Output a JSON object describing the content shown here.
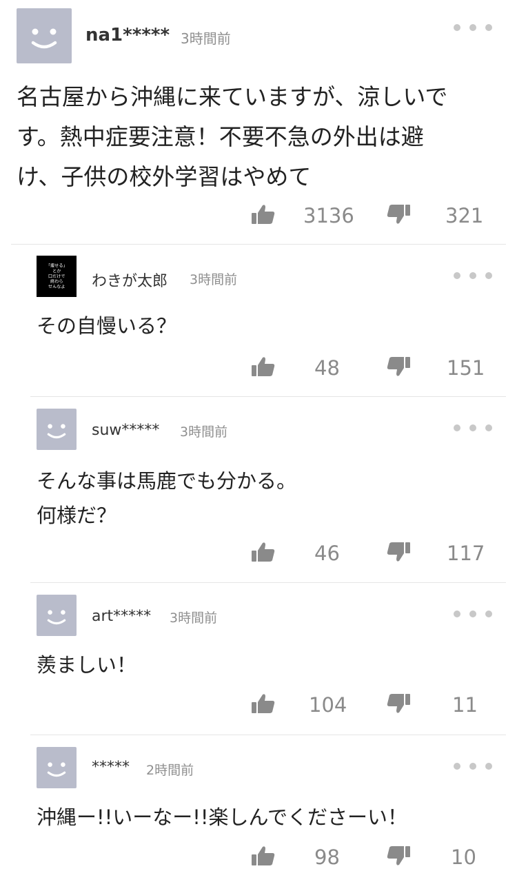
{
  "comments": [
    {
      "username": "na1*****",
      "time": "3時間前",
      "body": "名古屋から沖縄に来ていますが、涼しいで\nす。熱中症要注意！不要不急の外出は避\nけ、子供の校外学習はやめて",
      "likes": "3136",
      "dislikes": "321"
    },
    {
      "username": "わきが太郎",
      "time": "3時間前",
      "avatar_text": "「痩せる」\nとか\n口だけで\n終わら\nせんなよ",
      "body": "その自慢いる？",
      "likes": "48",
      "dislikes": "151"
    },
    {
      "username": "suw*****",
      "time": "3時間前",
      "body": "そんな事は馬鹿でも分かる。\n何様だ？",
      "likes": "46",
      "dislikes": "117"
    },
    {
      "username": "art*****",
      "time": "3時間前",
      "body": "羨ましい！",
      "likes": "104",
      "dislikes": "11"
    },
    {
      "username": "*****",
      "time": "2時間前",
      "body": "沖縄ー!!いーなー!!楽しんでくださーい！",
      "likes": "98",
      "dislikes": "10"
    }
  ],
  "icons": {
    "avatar": "default-smiley-avatar-icon",
    "more": "more-dots-icon",
    "like": "thumbs-up-icon",
    "dislike": "thumbs-down-icon"
  },
  "colors": {
    "avatar_bg": "#b9bccb",
    "divider": "#e5e5e5",
    "muted_text": "#8a8a8a"
  }
}
